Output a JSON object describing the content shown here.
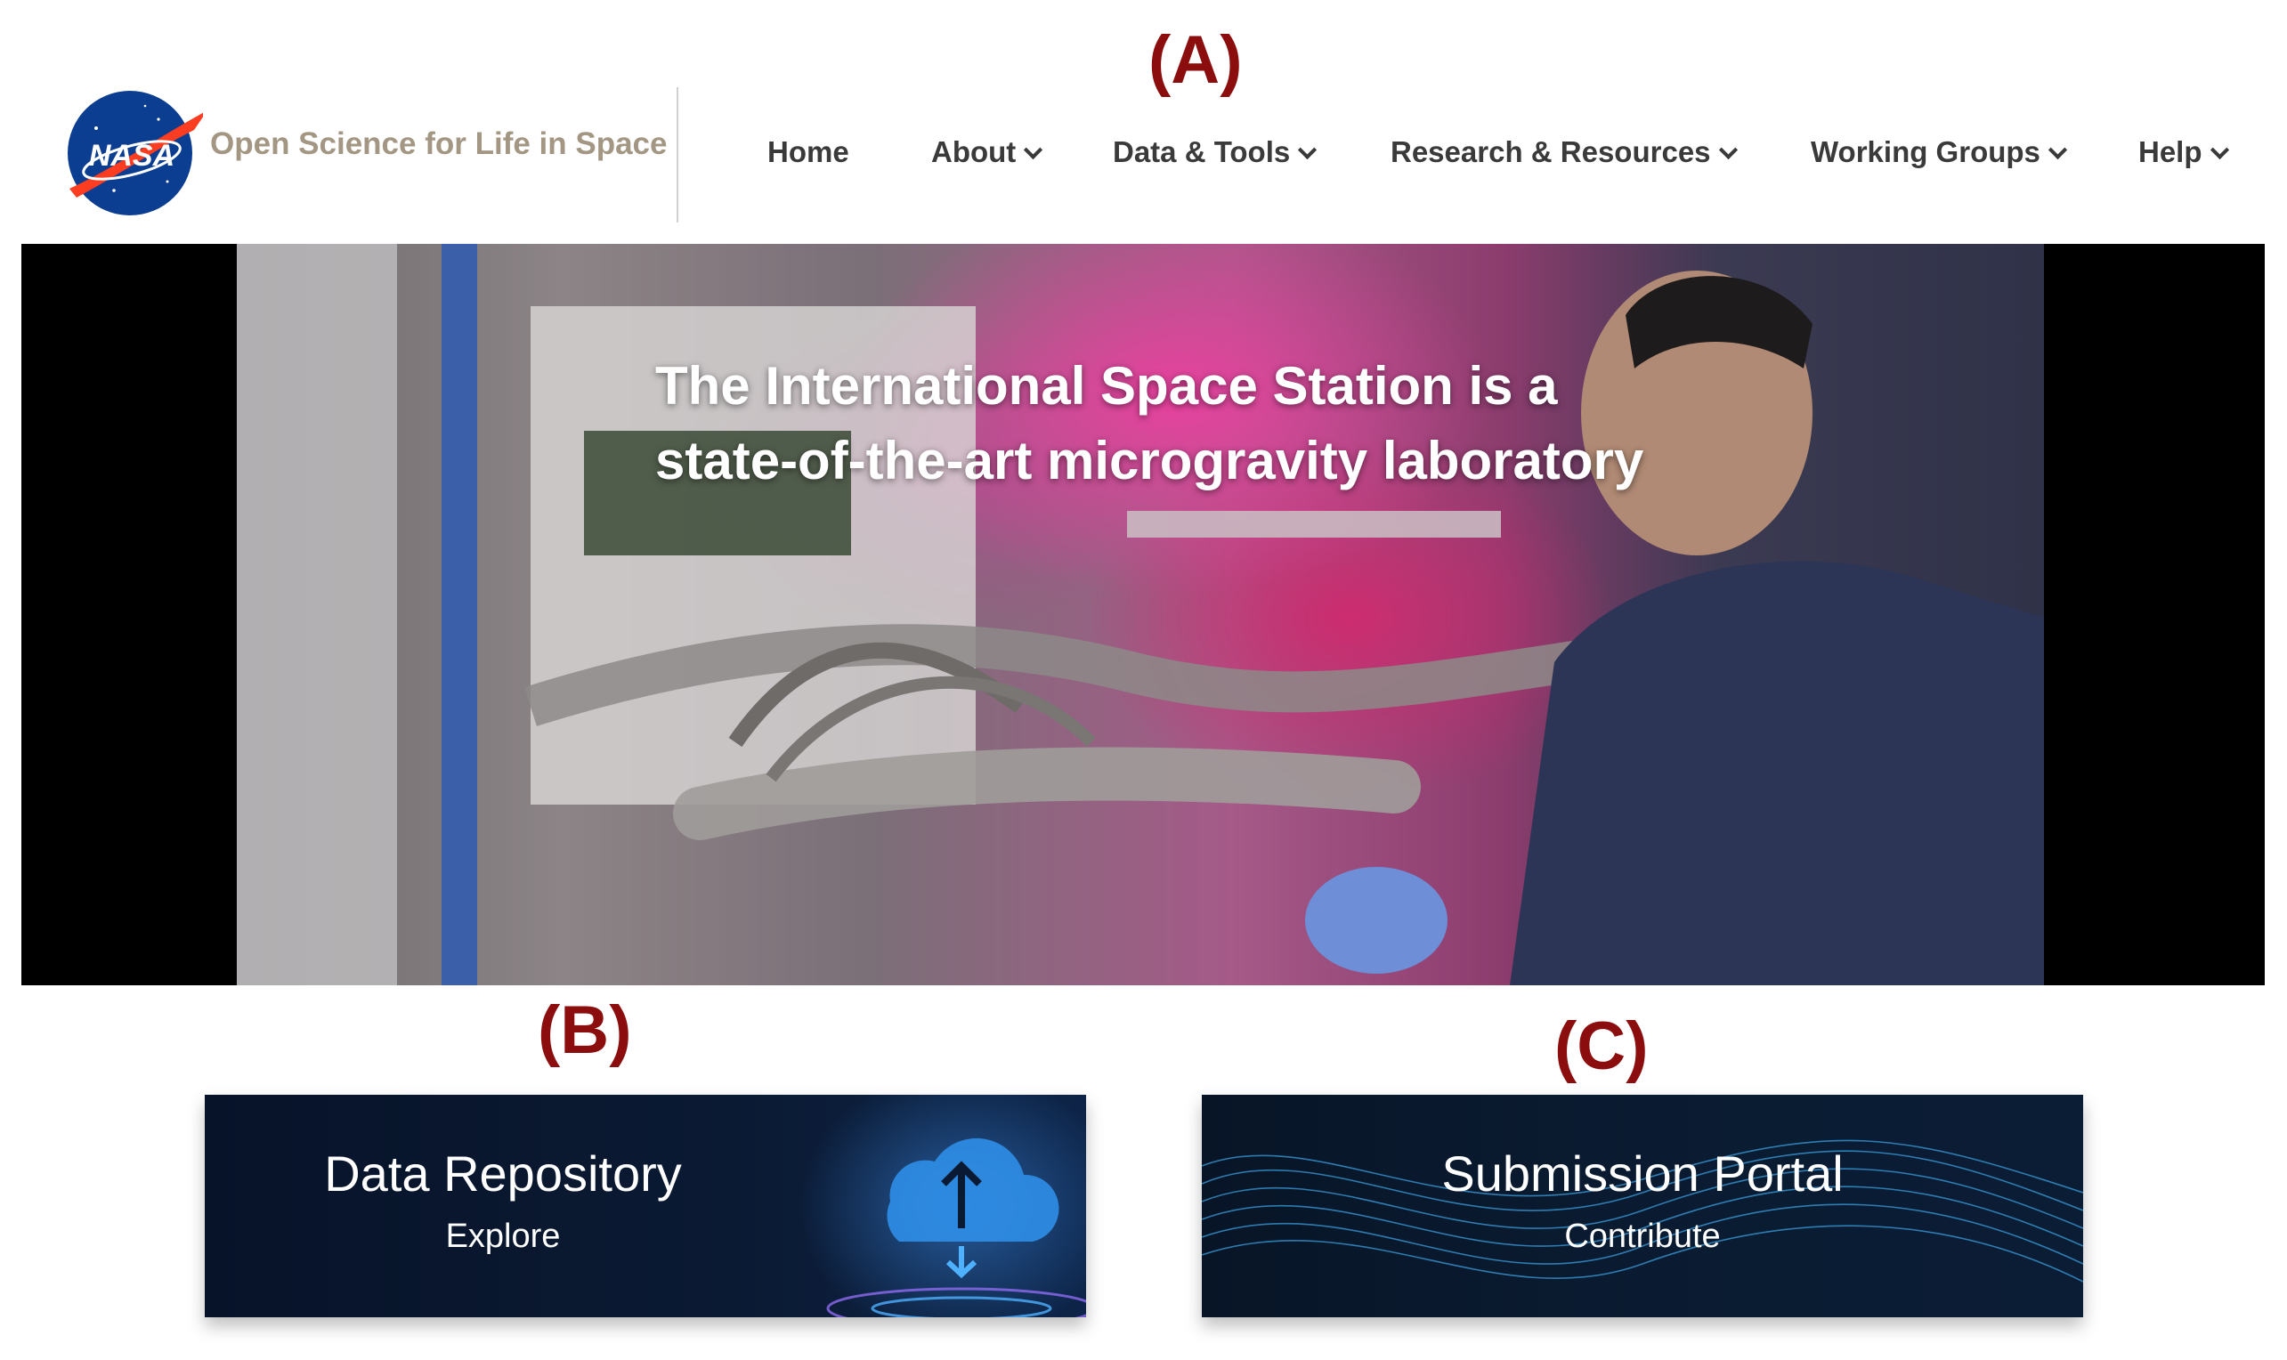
{
  "panel_labels": {
    "a": "(A)",
    "b": "(B)",
    "c": "(C)"
  },
  "header": {
    "logo_text": "NASA",
    "site_title": "Open Science for Life in Space",
    "nav": [
      {
        "label": "Home",
        "has_dropdown": false
      },
      {
        "label": "About",
        "has_dropdown": true
      },
      {
        "label": "Data & Tools",
        "has_dropdown": true
      },
      {
        "label": "Research & Resources",
        "has_dropdown": true
      },
      {
        "label": "Working Groups",
        "has_dropdown": true
      },
      {
        "label": "Help",
        "has_dropdown": true
      }
    ]
  },
  "hero": {
    "title_line1": "The International Space Station is a",
    "title_line2": "state-of-the-art microgravity laboratory"
  },
  "cards": {
    "repository": {
      "title": "Data Repository",
      "subtitle": "Explore",
      "icon": "cloud-upload-icon"
    },
    "submission": {
      "title": "Submission Portal",
      "subtitle": "Contribute",
      "icon": "wave-mesh-graphic"
    }
  },
  "colors": {
    "panel_label": "#8b0d0d",
    "site_title": "#a39784",
    "nav_text": "#3a3a3a",
    "nasa_blue": "#0b3d91",
    "nasa_red": "#fc3d21",
    "card_bg": "#0b1a33"
  }
}
